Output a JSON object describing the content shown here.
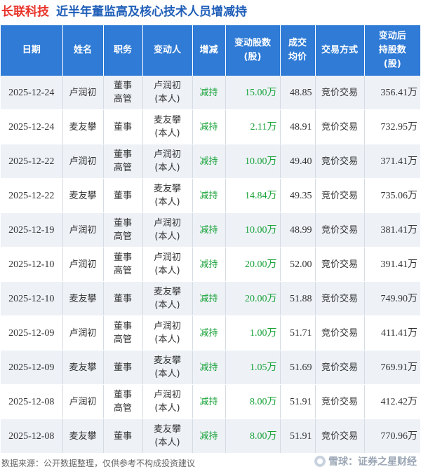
{
  "title": {
    "company": "长联科技",
    "topic": "近半年董监高及核心技术人员增减持"
  },
  "headers": [
    "日期",
    "姓名",
    "职务",
    "变动人",
    "增减",
    "变动股数\n(股)",
    "成交\n均价",
    "交易方式",
    "变动后\n持股数\n(股)"
  ],
  "rows": [
    {
      "date": "2025-12-24",
      "name": "卢润初",
      "role": "董事\n高管",
      "changer": "卢润初\n(本人)",
      "direction": "减持",
      "shares": "15.00万",
      "price": "48.85",
      "method": "竞价交易",
      "after": "356.41万"
    },
    {
      "date": "2025-12-24",
      "name": "麦友攀",
      "role": "董事",
      "changer": "麦友攀\n(本人)",
      "direction": "减持",
      "shares": "2.11万",
      "price": "48.91",
      "method": "竞价交易",
      "after": "732.95万"
    },
    {
      "date": "2025-12-22",
      "name": "卢润初",
      "role": "董事\n高管",
      "changer": "卢润初\n(本人)",
      "direction": "减持",
      "shares": "10.00万",
      "price": "49.40",
      "method": "竞价交易",
      "after": "371.41万"
    },
    {
      "date": "2025-12-22",
      "name": "麦友攀",
      "role": "董事",
      "changer": "麦友攀\n(本人)",
      "direction": "减持",
      "shares": "14.84万",
      "price": "49.35",
      "method": "竞价交易",
      "after": "735.06万"
    },
    {
      "date": "2025-12-19",
      "name": "卢润初",
      "role": "董事\n高管",
      "changer": "卢润初\n(本人)",
      "direction": "减持",
      "shares": "10.00万",
      "price": "48.99",
      "method": "竞价交易",
      "after": "381.41万"
    },
    {
      "date": "2025-12-10",
      "name": "卢润初",
      "role": "董事\n高管",
      "changer": "卢润初\n(本人)",
      "direction": "减持",
      "shares": "20.00万",
      "price": "52.00",
      "method": "竞价交易",
      "after": "391.41万"
    },
    {
      "date": "2025-12-10",
      "name": "麦友攀",
      "role": "董事",
      "changer": "麦友攀\n(本人)",
      "direction": "减持",
      "shares": "20.00万",
      "price": "51.88",
      "method": "竞价交易",
      "after": "749.90万"
    },
    {
      "date": "2025-12-09",
      "name": "卢润初",
      "role": "董事\n高管",
      "changer": "卢润初\n(本人)",
      "direction": "减持",
      "shares": "1.00万",
      "price": "51.71",
      "method": "竞价交易",
      "after": "411.41万"
    },
    {
      "date": "2025-12-09",
      "name": "麦友攀",
      "role": "董事",
      "changer": "麦友攀\n(本人)",
      "direction": "减持",
      "shares": "1.05万",
      "price": "51.69",
      "method": "竞价交易",
      "after": "769.91万"
    },
    {
      "date": "2025-12-08",
      "name": "卢润初",
      "role": "董事\n高管",
      "changer": "卢润初\n(本人)",
      "direction": "减持",
      "shares": "8.00万",
      "price": "51.91",
      "method": "竞价交易",
      "after": "412.42万"
    },
    {
      "date": "2025-12-08",
      "name": "麦友攀",
      "role": "董事",
      "changer": "麦友攀\n(本人)",
      "direction": "减持",
      "shares": "8.00万",
      "price": "51.91",
      "method": "竞价交易",
      "after": "770.96万"
    }
  ],
  "footer": {
    "source": "数据来源：公开数据整理，仅供参考不构成投资建议",
    "brand": "雪球：证券之星财经"
  },
  "colors": {
    "header_bg": "#2f7bd6",
    "company": "#e8332a",
    "topic": "#1f5eb8",
    "reduce": "#1aa33a",
    "row_alt": "#eef2f7"
  }
}
